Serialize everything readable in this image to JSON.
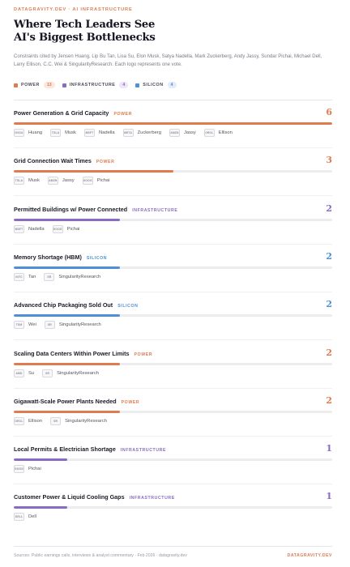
{
  "header": {
    "eyebrow": "DATAGRAVITY.DEV · AI INFRASTRUCTURE",
    "title": "Where Tech Leaders See AI's Biggest Bottlenecks",
    "subtitle": "Constraints cited by Jensen Huang, Lip Bu Tan, Lisa Su, Elon Musk, Satya Nadella, Mark Zuckerberg, Andy Jassy, Sundar Pichai, Michael Dell, Larry Ellison, C.C. Wei & SingularityResearch. Each logo represents one vote."
  },
  "colors": {
    "POWER": "#e07a4f",
    "INFRASTRUCTURE": "#8a6bc4",
    "SILICON": "#4f8fd6",
    "POWER_badge_bg": "#fbe7dd",
    "INFRASTRUCTURE_badge_bg": "#ece6f6",
    "SILICON_badge_bg": "#e2edf9"
  },
  "legend": [
    {
      "label": "POWER",
      "count": "13",
      "category": "POWER"
    },
    {
      "label": "INFRASTRUCTURE",
      "count": "4",
      "category": "INFRASTRUCTURE"
    },
    {
      "label": "SILICON",
      "count": "4",
      "category": "SILICON"
    }
  ],
  "chart_data": {
    "type": "bar",
    "max_value": 6,
    "categories": [
      "Power Generation & Grid Capacity",
      "Grid Connection Wait Times",
      "Permitted Buildings w/ Power Connected",
      "Memory Shortage (HBM)",
      "Advanced Chip Packaging Sold Out",
      "Scaling Data Centers Within Power Limits",
      "Gigawatt-Scale Power Plants Needed",
      "Local Permits & Electrician Shortage",
      "Customer Power & Liquid Cooling Gaps"
    ],
    "values": [
      6,
      3,
      2,
      2,
      2,
      2,
      2,
      1,
      1
    ],
    "rows": [
      {
        "label": "Power Generation & Grid Capacity",
        "category": "POWER",
        "value": 6,
        "people": [
          {
            "logo": "NVDA",
            "name": "Huang"
          },
          {
            "logo": "TSLA",
            "name": "Musk"
          },
          {
            "logo": "MSFT",
            "name": "Nadella"
          },
          {
            "logo": "META",
            "name": "Zuckerberg"
          },
          {
            "logo": "AMZN",
            "name": "Jassy"
          },
          {
            "logo": "ORCL",
            "name": "Ellison"
          }
        ]
      },
      {
        "label": "Grid Connection Wait Times",
        "category": "POWER",
        "value": 3,
        "people": [
          {
            "logo": "TSLA",
            "name": "Musk"
          },
          {
            "logo": "AMZN",
            "name": "Jassy"
          },
          {
            "logo": "GOOG",
            "name": "Pichai"
          }
        ]
      },
      {
        "label": "Permitted Buildings w/ Power Connected",
        "category": "INFRASTRUCTURE",
        "value": 2,
        "people": [
          {
            "logo": "MSFT",
            "name": "Nadella"
          },
          {
            "logo": "GOOG",
            "name": "Pichai"
          }
        ]
      },
      {
        "label": "Memory Shortage (HBM)",
        "category": "SILICON",
        "value": 2,
        "people": [
          {
            "logo": "INTC",
            "name": "Tan"
          },
          {
            "logo": "SR",
            "name": "SingularityResearch"
          }
        ]
      },
      {
        "label": "Advanced Chip Packaging Sold Out",
        "category": "SILICON",
        "value": 2,
        "people": [
          {
            "logo": "TSM",
            "name": "Wei"
          },
          {
            "logo": "SR",
            "name": "SingularityResearch"
          }
        ]
      },
      {
        "label": "Scaling Data Centers Within Power Limits",
        "category": "POWER",
        "value": 2,
        "people": [
          {
            "logo": "AMD",
            "name": "Su"
          },
          {
            "logo": "SR",
            "name": "SingularityResearch"
          }
        ]
      },
      {
        "label": "Gigawatt-Scale Power Plants Needed",
        "category": "POWER",
        "value": 2,
        "people": [
          {
            "logo": "ORCL",
            "name": "Ellison"
          },
          {
            "logo": "SR",
            "name": "SingularityResearch"
          }
        ]
      },
      {
        "label": "Local Permits & Electrician Shortage",
        "category": "INFRASTRUCTURE",
        "value": 1,
        "people": [
          {
            "logo": "GOOG",
            "name": "Pichai"
          }
        ]
      },
      {
        "label": "Customer Power & Liquid Cooling Gaps",
        "category": "INFRASTRUCTURE",
        "value": 1,
        "people": [
          {
            "logo": "DELL",
            "name": "Dell"
          }
        ]
      }
    ]
  },
  "footer": {
    "sources": "Sources: Public earnings calls, interviews & analyst commentary · Feb 2026 · datagravity.dev",
    "brand": "DATAGRAVITY.DEV"
  }
}
